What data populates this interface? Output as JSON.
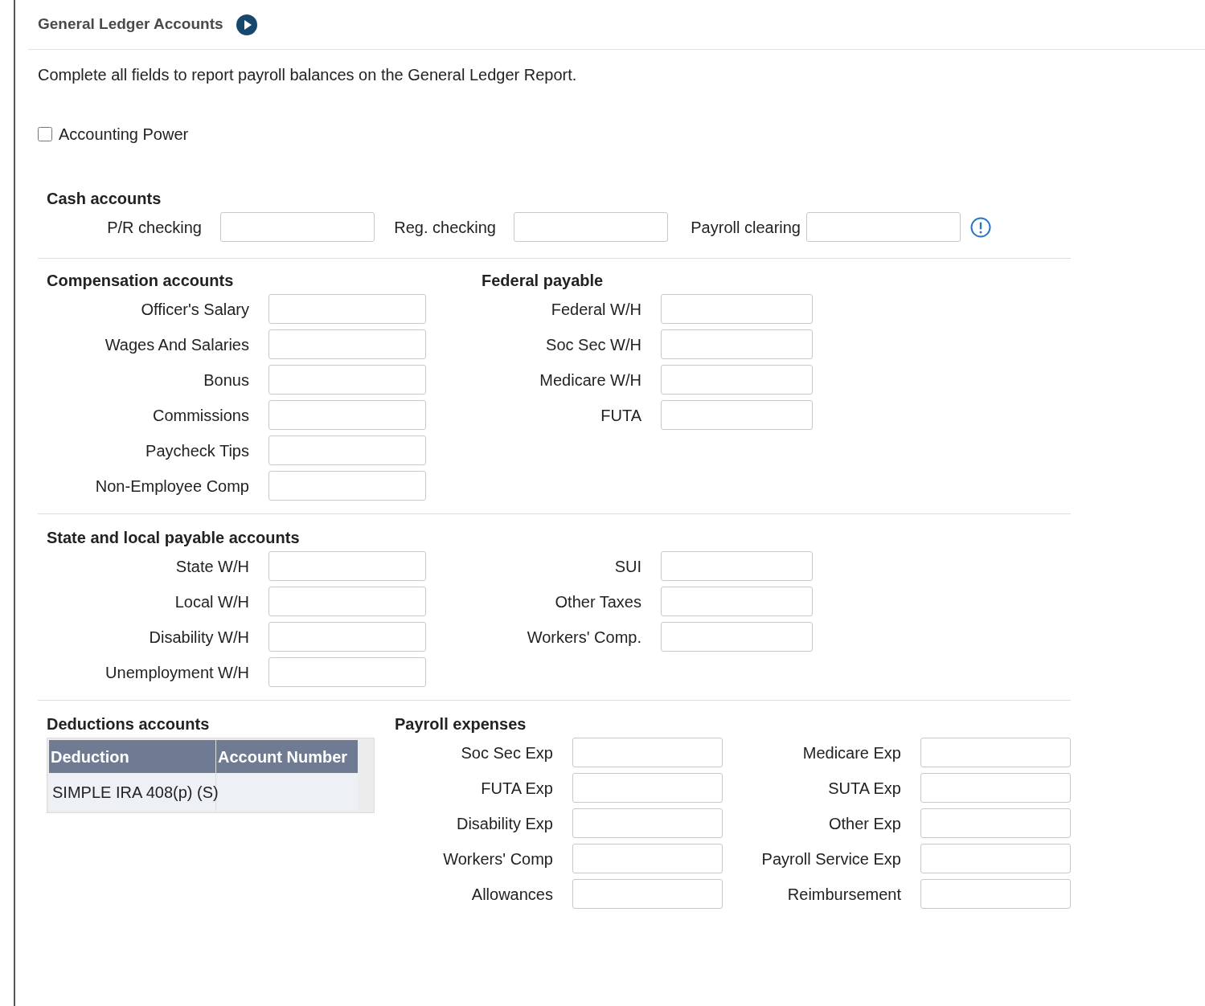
{
  "header": {
    "title": "General Ledger Accounts"
  },
  "intro": "Complete all fields to report payroll balances on the General Ledger Report.",
  "accounting_power": {
    "label": "Accounting Power",
    "checked": false
  },
  "cash_accounts": {
    "title": "Cash accounts",
    "fields": [
      {
        "label": "P/R checking"
      },
      {
        "label": "Reg. checking"
      },
      {
        "label": "Payroll clearing"
      }
    ]
  },
  "compensation_accounts": {
    "title": "Compensation accounts",
    "fields": [
      {
        "label": "Officer's Salary"
      },
      {
        "label": "Wages And Salaries"
      },
      {
        "label": "Bonus"
      },
      {
        "label": "Commissions"
      },
      {
        "label": "Paycheck Tips"
      },
      {
        "label": "Non-Employee Comp"
      }
    ]
  },
  "federal_payable": {
    "title": "Federal payable",
    "fields": [
      {
        "label": "Federal W/H"
      },
      {
        "label": "Soc Sec W/H"
      },
      {
        "label": "Medicare W/H"
      },
      {
        "label": "FUTA"
      }
    ]
  },
  "state_local_payable": {
    "title": "State and local payable accounts",
    "left_fields": [
      {
        "label": "State W/H"
      },
      {
        "label": "Local W/H"
      },
      {
        "label": "Disability W/H"
      },
      {
        "label": "Unemployment W/H"
      }
    ],
    "right_fields": [
      {
        "label": "SUI"
      },
      {
        "label": "Other Taxes"
      },
      {
        "label": "Workers' Comp."
      }
    ]
  },
  "deductions_accounts": {
    "title": "Deductions accounts",
    "columns": [
      "Deduction",
      "Account Number"
    ],
    "rows": [
      {
        "deduction": "SIMPLE IRA 408(p) (S)"
      }
    ]
  },
  "payroll_expenses": {
    "title": "Payroll expenses",
    "left_fields": [
      {
        "label": "Soc Sec Exp"
      },
      {
        "label": "FUTA Exp"
      },
      {
        "label": "Disability Exp"
      },
      {
        "label": "Workers' Comp"
      },
      {
        "label": "Allowances"
      }
    ],
    "right_fields": [
      {
        "label": "Medicare Exp"
      },
      {
        "label": "SUTA Exp"
      },
      {
        "label": "Other Exp"
      },
      {
        "label": "Payroll Service Exp"
      },
      {
        "label": "Reimbursement"
      }
    ]
  }
}
